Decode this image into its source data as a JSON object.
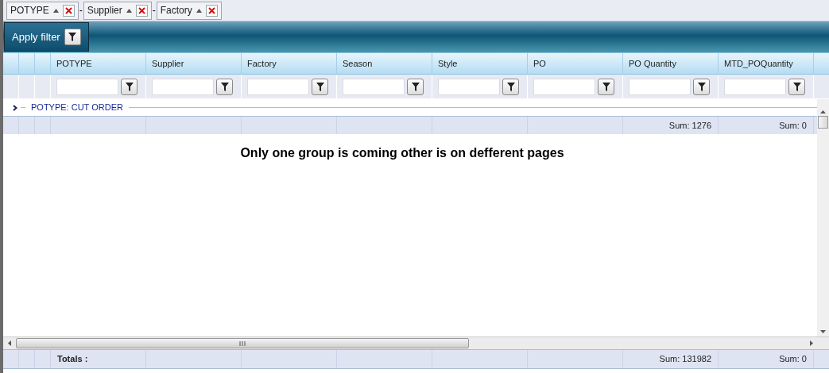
{
  "group_panel": [
    {
      "label": "POTYPE",
      "ascending": true
    },
    {
      "label": "Supplier",
      "ascending": true
    },
    {
      "label": "Factory",
      "ascending": true
    }
  ],
  "group_separator": "-",
  "toolbar": {
    "apply_button": "Apply filter"
  },
  "columns": [
    {
      "header": "POTYPE"
    },
    {
      "header": "Supplier"
    },
    {
      "header": "Factory"
    },
    {
      "header": "Season"
    },
    {
      "header": "Style"
    },
    {
      "header": "PO"
    },
    {
      "header": "PO Quantity",
      "group_sum": "Sum: 1276",
      "total": "Sum: 131982"
    },
    {
      "header": "MTD_POQuantity",
      "group_sum": "Sum: 0",
      "total": "Sum: 0"
    }
  ],
  "group_row": {
    "label": "POTYPE: CUT ORDER",
    "expanded": false
  },
  "message": "Only one group is coming other is on defferent pages",
  "totals_label": "Totals :"
}
